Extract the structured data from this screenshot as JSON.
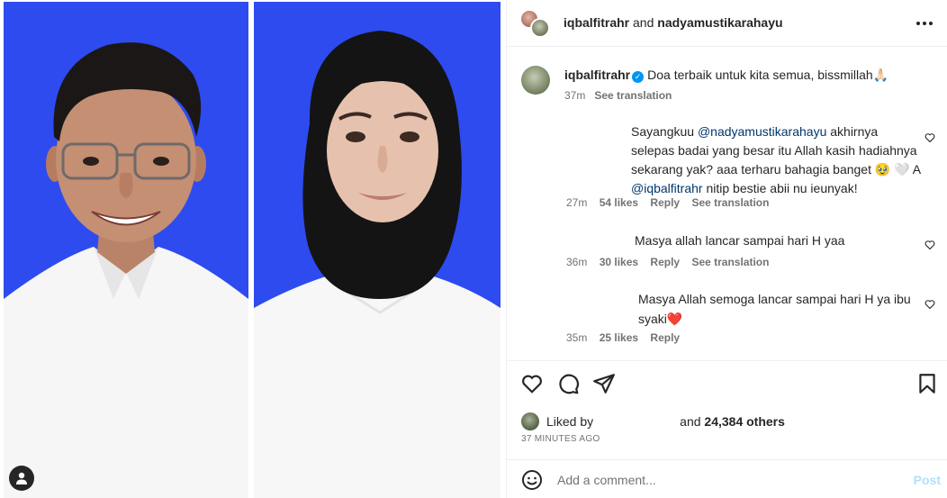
{
  "header": {
    "user1": "iqbalfitrahr",
    "connector": "and",
    "user2": "nadyamustikarahayu",
    "more_icon": "more-horizontal-icon"
  },
  "caption": {
    "username": "iqbalfitrahr",
    "text": "Doa terbaik untuk kita semua, bissmillah",
    "emoji": "🙏🏻",
    "time": "37m",
    "see_translation": "See translation"
  },
  "comments": [
    {
      "text_before": "Sayangkuu ",
      "mention": "@nadyamustikarahayu",
      "text_mid": " akhirnya selepas badai yang besar itu Allah kasih hadiahnya sekarang yak? aaa terharu bahagia banget 🥹 🤍 A ",
      "mention2": "@iqbalfitrahr",
      "text_after": " nitip bestie abii nu ieunyak!",
      "time": "27m",
      "likes": "54 likes",
      "reply": "Reply",
      "see_translation": "See translation"
    },
    {
      "text": "Masya allah lancar sampai hari H yaa",
      "time": "36m",
      "likes": "30 likes",
      "reply": "Reply",
      "see_translation": "See translation"
    },
    {
      "text": "Masya Allah semoga lancar sampai hari H ya ibu syaki❤️",
      "time": "35m",
      "likes": "25 likes",
      "reply": "Reply"
    }
  ],
  "likes": {
    "prefix": "Liked by",
    "suffix": "and",
    "count": "24,384 others"
  },
  "time_ago": "37 MINUTES AGO",
  "add_comment": {
    "placeholder": "Add a comment...",
    "post_label": "Post"
  },
  "colors": {
    "photo_background": "#2e4bf0",
    "link": "#00376b",
    "verified": "#0095f6",
    "post_disabled": "#b2dffc"
  }
}
